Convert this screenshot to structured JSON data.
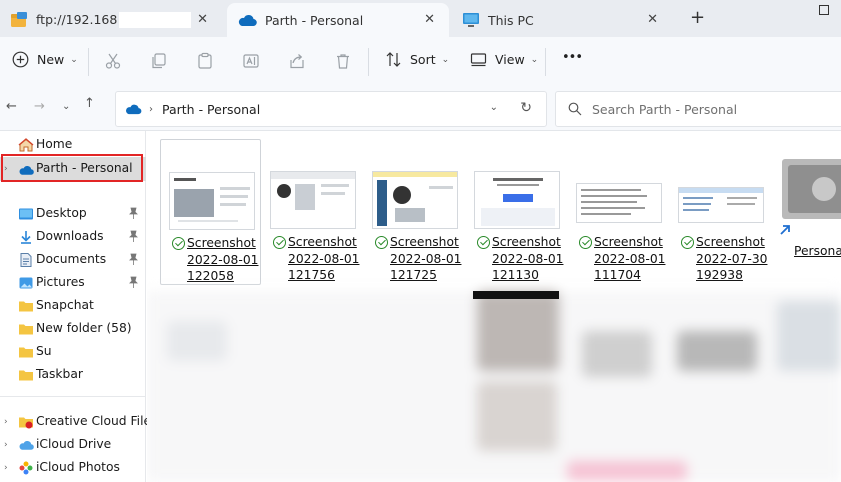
{
  "tabs": [
    {
      "title": "ftp://192.168",
      "icon": "ftp-folder-icon",
      "active": false
    },
    {
      "title": "Parth - Personal",
      "icon": "onedrive-cloud-icon",
      "active": true
    },
    {
      "title": "This PC",
      "icon": "monitor-icon",
      "active": false
    }
  ],
  "window": {
    "new_tab": "+",
    "maximize": "maximize"
  },
  "toolbar": {
    "new_label": "New",
    "sort_label": "Sort",
    "view_label": "View",
    "more_label": "•••"
  },
  "address": {
    "path": "Parth - Personal"
  },
  "search": {
    "placeholder": "Search Parth - Personal"
  },
  "sidebar": {
    "items": [
      {
        "label": "Home",
        "icon": "home-icon"
      },
      {
        "label": "Parth - Personal",
        "icon": "onedrive-cloud-icon",
        "selected": true
      },
      {
        "label": "Desktop",
        "icon": "desktop-folder-icon",
        "pinned": true
      },
      {
        "label": "Downloads",
        "icon": "download-icon",
        "pinned": true
      },
      {
        "label": "Documents",
        "icon": "document-icon",
        "pinned": true
      },
      {
        "label": "Pictures",
        "icon": "pictures-icon",
        "pinned": true
      },
      {
        "label": "Snapchat",
        "icon": "folder-icon"
      },
      {
        "label": "New folder (58)",
        "icon": "folder-icon"
      },
      {
        "label": "Su",
        "icon": "folder-icon"
      },
      {
        "label": "Taskbar",
        "icon": "folder-icon"
      },
      {
        "label": "Creative Cloud Files",
        "icon": "creative-cloud-icon"
      },
      {
        "label": "iCloud Drive",
        "icon": "icloud-icon"
      },
      {
        "label": "iCloud Photos",
        "icon": "icloud-photos-icon"
      }
    ]
  },
  "files": [
    {
      "name": "Screenshot\n2022-08-01\n122058",
      "selected": true
    },
    {
      "name": "Screenshot\n2022-08-01\n121756"
    },
    {
      "name": "Screenshot\n2022-08-01\n121725"
    },
    {
      "name": "Screenshot\n2022-08-01\n121130"
    },
    {
      "name": "Screenshot\n2022-08-01\n111704"
    },
    {
      "name": "Screenshot\n2022-07-30\n192938"
    },
    {
      "name": "Personal V"
    }
  ],
  "colors": {
    "accent": "#0f6cbd",
    "selection_box": "#e22525",
    "sync_check": "#2a8a2a",
    "folder": "#f4c542"
  }
}
